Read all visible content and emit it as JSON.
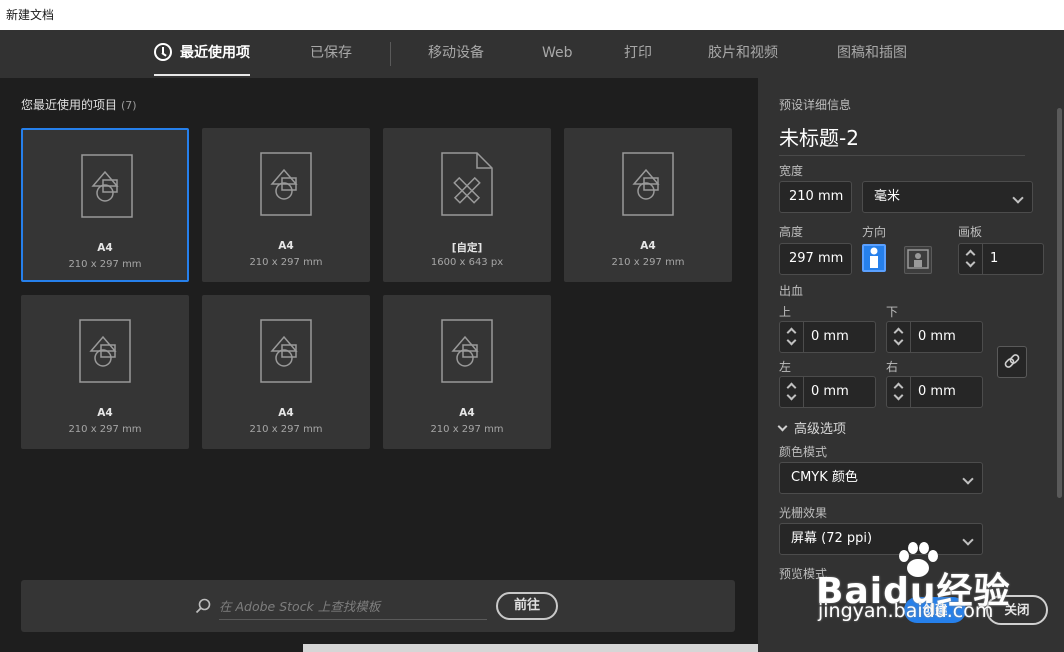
{
  "window": {
    "title": "新建文档"
  },
  "tabs": [
    {
      "label": "最近使用项",
      "active": true
    },
    {
      "label": "已保存"
    },
    {
      "label": "移动设备"
    },
    {
      "label": "Web"
    },
    {
      "label": "打印"
    },
    {
      "label": "胶片和视频"
    },
    {
      "label": "图稿和插图"
    }
  ],
  "recent": {
    "header": "您最近使用的项目",
    "count": "(7)",
    "cards": [
      {
        "name": "A4",
        "size": "210 x 297 mm",
        "icon": "document-shapes-icon",
        "selected": true
      },
      {
        "name": "A4",
        "size": "210 x 297 mm",
        "icon": "document-shapes-icon"
      },
      {
        "name": "[自定]",
        "size": "1600 x 643 px",
        "icon": "custom-document-icon"
      },
      {
        "name": "A4",
        "size": "210 x 297 mm",
        "icon": "document-shapes-icon"
      },
      {
        "name": "A4",
        "size": "210 x 297 mm",
        "icon": "document-shapes-icon"
      },
      {
        "name": "A4",
        "size": "210 x 297 mm",
        "icon": "document-shapes-icon"
      },
      {
        "name": "A4",
        "size": "210 x 297 mm",
        "icon": "document-shapes-icon"
      }
    ]
  },
  "stock_search": {
    "placeholder": "在 Adobe Stock 上查找模板",
    "value": "",
    "go_label": "前往"
  },
  "preset": {
    "section_label": "预设详细信息",
    "title": "未标题-2",
    "width_label": "宽度",
    "width_value": "210 mm",
    "unit_value": "毫米",
    "height_label": "高度",
    "height_value": "297 mm",
    "orientation_label": "方向",
    "orientation": "portrait",
    "artboards_label": "画板",
    "artboards_value": "1",
    "bleed_label": "出血",
    "bleed_top_label": "上",
    "bleed_top_value": "0 mm",
    "bleed_bottom_label": "下",
    "bleed_bottom_value": "0 mm",
    "bleed_left_label": "左",
    "bleed_left_value": "0 mm",
    "bleed_right_label": "右",
    "bleed_right_value": "0 mm",
    "advanced_label": "高级选项",
    "color_mode_label": "颜色模式",
    "color_mode_value": "CMYK 颜色",
    "raster_label": "光栅效果",
    "raster_value": "屏幕 (72 ppi)",
    "preview_label": "预览模式"
  },
  "actions": {
    "create_label": "创建",
    "close_label": "关闭"
  },
  "watermark": {
    "brand": "Baidu经验",
    "url": "jingyan.baidu.com"
  },
  "colors": {
    "accent": "#2680eb",
    "panel": "#323232",
    "background": "#1e1e1e"
  }
}
